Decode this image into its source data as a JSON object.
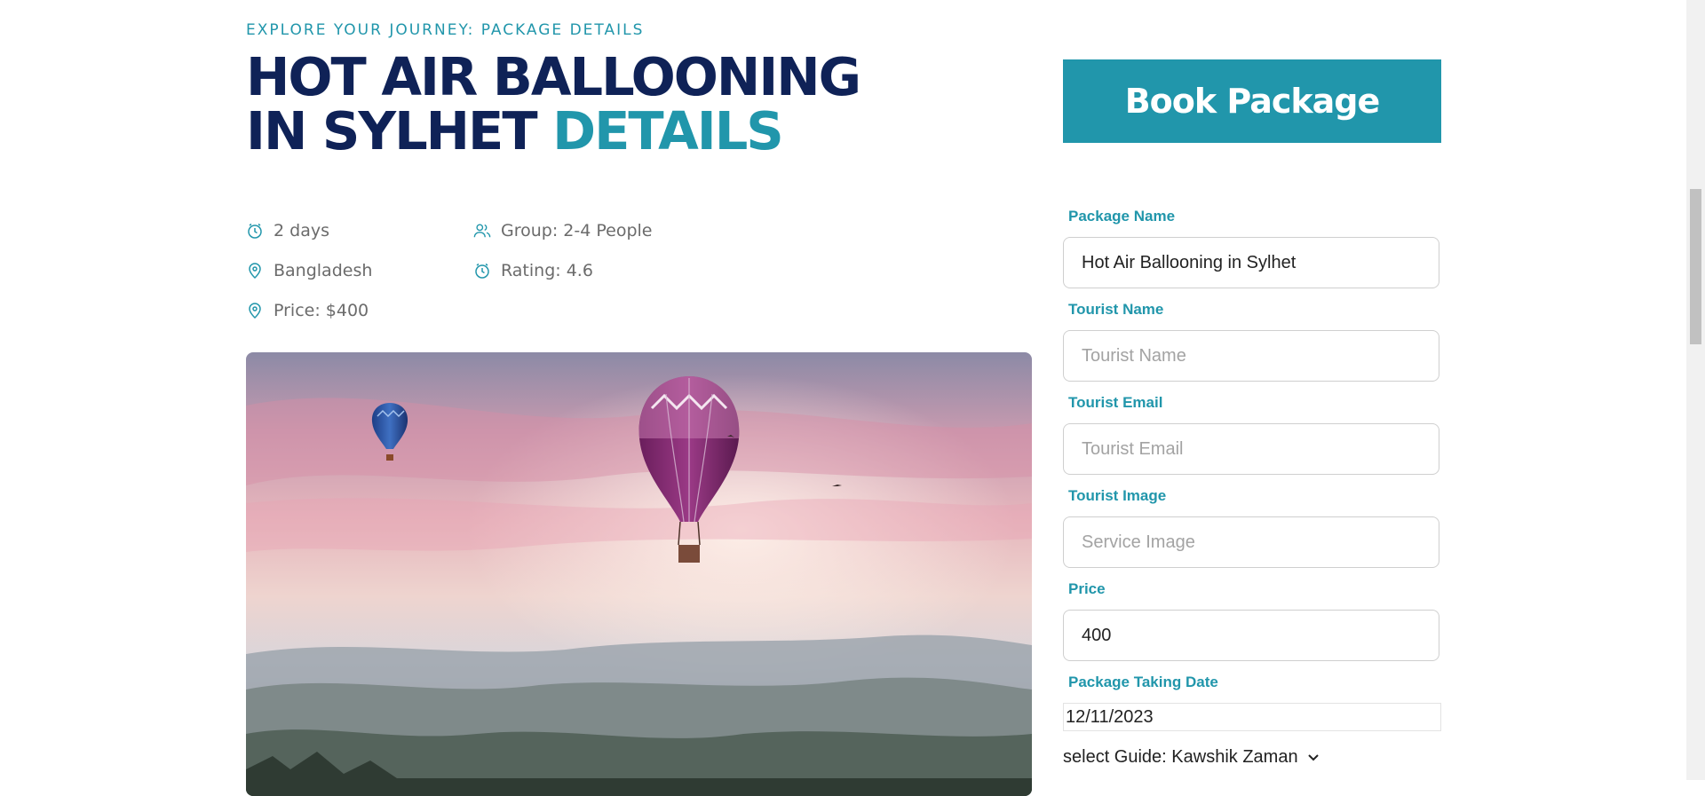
{
  "header": {
    "eyebrow": "EXPLORE YOUR JOURNEY: PACKAGE DETAILS",
    "title_main": "HOT AIR BALLOONING IN SYLHET",
    "title_accent": "DETAILS"
  },
  "meta": {
    "duration": "2 days",
    "location": "Bangladesh",
    "price": "Price: $400",
    "group": "Group: 2-4 People",
    "rating": "Rating: 4.6"
  },
  "booking": {
    "book_label": "Book Package",
    "fields": [
      {
        "label": "Package Name",
        "value": "Hot Air Ballooning in Sylhet",
        "placeholder": ""
      },
      {
        "label": "Tourist Name",
        "value": "",
        "placeholder": "Tourist Name"
      },
      {
        "label": "Tourist Email",
        "value": "",
        "placeholder": "Tourist Email"
      },
      {
        "label": "Tourist Image",
        "value": "",
        "placeholder": "Service Image"
      },
      {
        "label": "Price",
        "value": "400",
        "placeholder": ""
      }
    ],
    "date_label": "Package Taking Date",
    "date_value": "12/11/2023",
    "guide_label": "select Guide: Kawshik Zaman"
  },
  "colors": {
    "accent": "#2196ab",
    "navy": "#0f2257"
  },
  "icons": {
    "duration": "clock-icon",
    "location": "map-pin-icon",
    "price": "map-pin-icon",
    "group": "users-icon",
    "rating": "clock-icon",
    "guide": "chevron-down-icon"
  }
}
